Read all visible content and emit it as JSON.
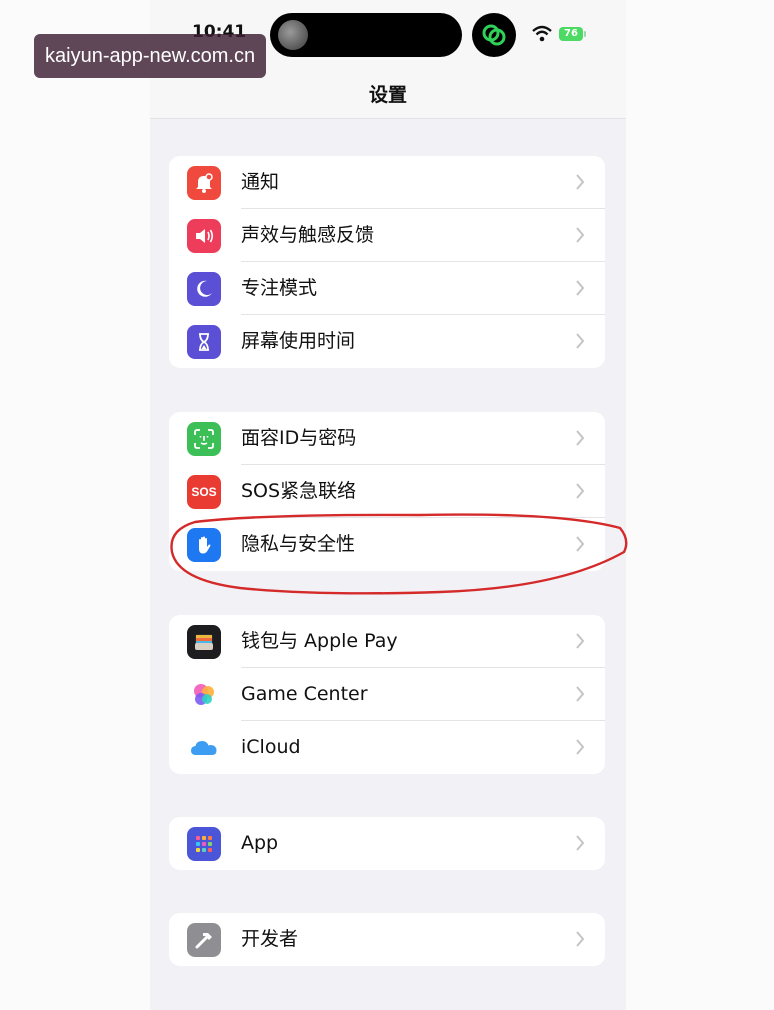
{
  "status_bar": {
    "time": "10:41",
    "battery": "76"
  },
  "nav": {
    "title": "设置"
  },
  "watermark": "kaiyun-app-new.com.cn",
  "groups": [
    {
      "items": [
        {
          "label": "通知",
          "icon": "bell-icon",
          "color": "#f04a3f"
        },
        {
          "label": "声效与触感反馈",
          "icon": "speaker-icon",
          "color": "#ee3d5b"
        },
        {
          "label": "专注模式",
          "icon": "moon-icon",
          "color": "#5b4fd6"
        },
        {
          "label": "屏幕使用时间",
          "icon": "hourglass-icon",
          "color": "#5b4fd6"
        }
      ]
    },
    {
      "items": [
        {
          "label": "面容ID与密码",
          "icon": "faceid-icon",
          "color": "#3dbf58"
        },
        {
          "label": "SOS紧急联络",
          "icon": "sos-icon",
          "color": "#ea3b33",
          "icon_text": "SOS"
        },
        {
          "label": "隐私与安全性",
          "icon": "hand-icon",
          "color": "#1d78f2"
        }
      ]
    },
    {
      "items": [
        {
          "label": "钱包与 Apple Pay",
          "icon": "wallet-icon",
          "color": "#1d1d1f"
        },
        {
          "label": "Game Center",
          "icon": "game-center-icon",
          "color": "#ffffff"
        },
        {
          "label": "iCloud",
          "icon": "cloud-icon",
          "color": "#ffffff"
        }
      ]
    },
    {
      "items": [
        {
          "label": "App",
          "icon": "app-grid-icon",
          "color": "#4b55d8"
        }
      ]
    },
    {
      "items": [
        {
          "label": "开发者",
          "icon": "hammer-icon",
          "color": "#8e8e93"
        }
      ]
    }
  ],
  "annotation_color": "#d42a2a"
}
